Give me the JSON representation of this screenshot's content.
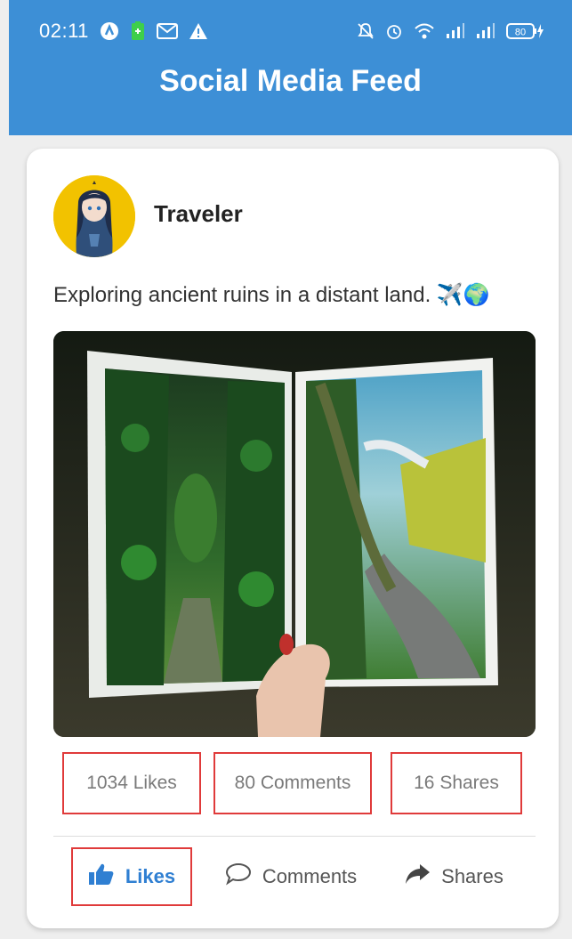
{
  "status_bar": {
    "time": "02:11",
    "left_icons": [
      "app-icon",
      "battery-saver-icon",
      "gmail-icon",
      "warning-icon"
    ],
    "right_icons": [
      "mute-icon",
      "alarm-icon",
      "wifi-icon",
      "signal-icon",
      "signal-icon",
      "battery-icon"
    ],
    "battery": "80"
  },
  "app_bar": {
    "title": "Social Media Feed",
    "color": "#3d8fd6"
  },
  "post": {
    "author": "Traveler",
    "text": "Exploring ancient ruins in a distant land. ✈️🌍",
    "stats": {
      "likes": "1034 Likes",
      "comments": "80 Comments",
      "shares": "16 Shares"
    },
    "actions": {
      "like": "Likes",
      "comment": "Comments",
      "share": "Shares"
    }
  },
  "colors": {
    "accent": "#2f7fd2",
    "highlight_border": "#e03a3a"
  }
}
